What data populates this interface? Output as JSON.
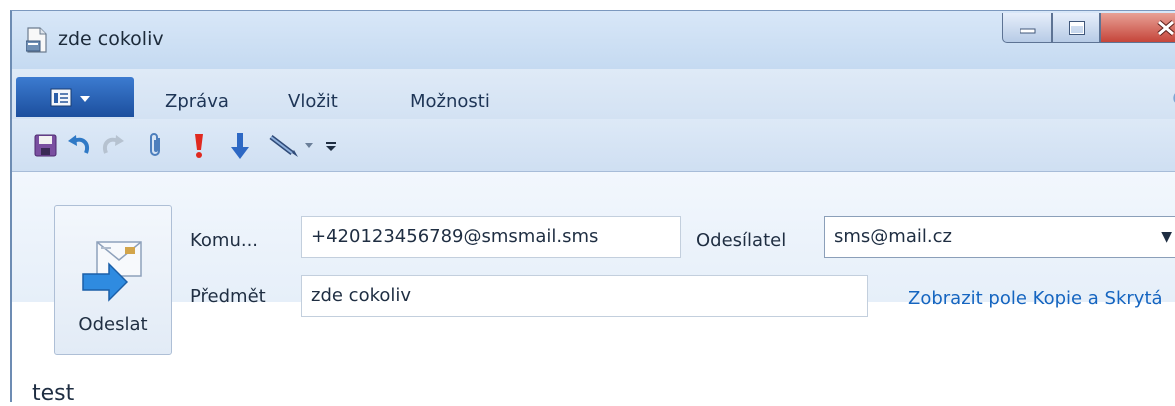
{
  "window": {
    "title": "zde cokoliv",
    "controls": {
      "minimize": "minimize",
      "maximize": "maximize",
      "close": "close"
    }
  },
  "ribbon": {
    "file_button_icon": "file-menu-icon",
    "tabs": [
      {
        "label": "Zpráva"
      },
      {
        "label": "Vložit"
      },
      {
        "label": "Možnosti"
      }
    ]
  },
  "quick_access": {
    "icons": [
      "save-icon",
      "undo-icon",
      "redo-icon",
      "attach-icon",
      "high-importance-icon",
      "low-importance-icon",
      "signature-icon",
      "customize-icon"
    ]
  },
  "compose": {
    "send_label": "Odeslat",
    "to_label": "Komu...",
    "to_value": "+420123456789@smsmail.sms",
    "from_label": "Odesílatel",
    "from_value": "sms@mail.cz",
    "subject_label": "Předmět",
    "subject_value": "zde cokoliv",
    "cc_link": "Zobrazit pole Kopie a Skrytá"
  },
  "message": {
    "body": "test"
  },
  "colors": {
    "accent": "#1c4f9e",
    "link": "#1565c0",
    "close": "#c5453a"
  }
}
